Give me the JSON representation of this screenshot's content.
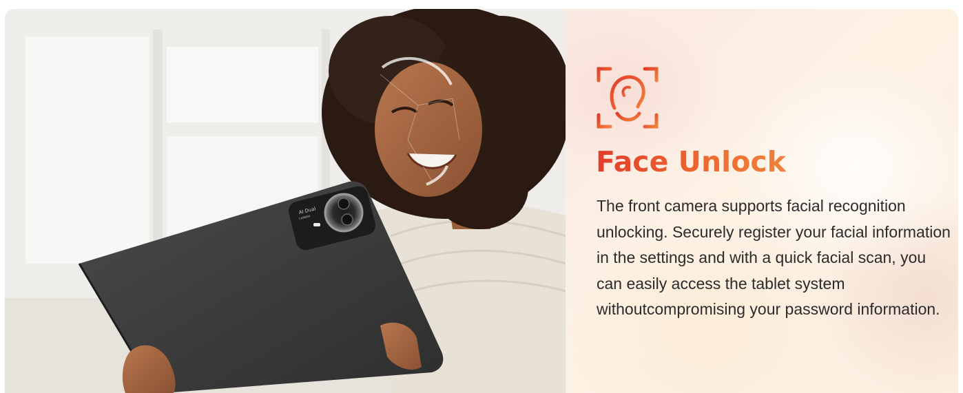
{
  "feature": {
    "icon": "face-scan-icon",
    "title": "Face Unlock",
    "description": "The front camera supports facial recognition unlocking. Securely register your facial information in the settings and with a quick facial scan, you can easily access the tablet system withoutcompromising your password information."
  },
  "device_label": {
    "line1": "AI Dual",
    "line2": "CAMERA"
  },
  "colors": {
    "accent": "#e6452a",
    "accent_light": "#f0813a",
    "body_text": "#2b2b2b",
    "tablet": "#3a3a3a"
  }
}
